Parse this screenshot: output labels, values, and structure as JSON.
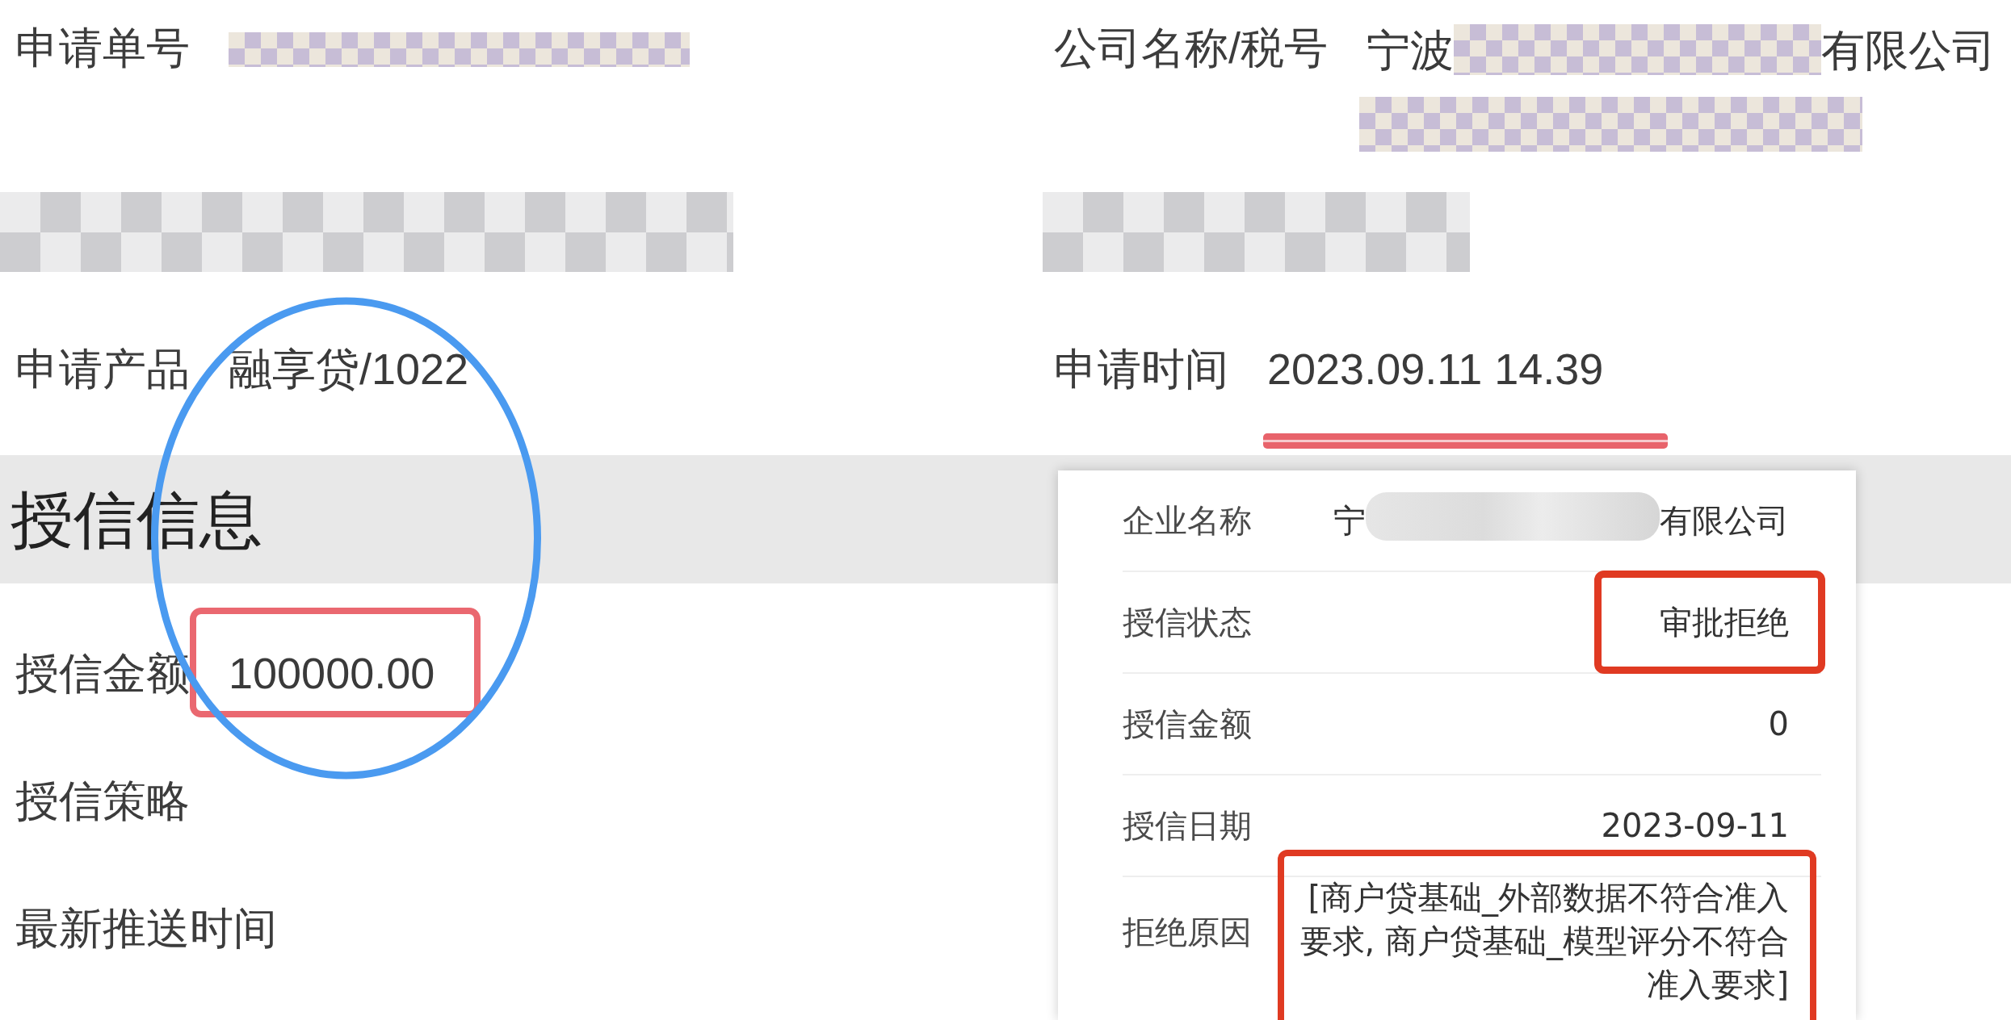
{
  "application_fields": [
    {
      "kind": "masked",
      "label": "申请单号"
    },
    {
      "kind": "company",
      "label": "公司名称/税号",
      "value_start": "宁波",
      "value_end": "有限公司"
    },
    {
      "kind": "masked_row"
    },
    {
      "kind": "masked_row"
    },
    {
      "kind": "text",
      "label": "申请产品",
      "value": "融享贷/1022",
      "underlined": false
    },
    {
      "kind": "text",
      "label": "申请时间",
      "value": "2023.09.11 14.39",
      "underlined": true
    }
  ],
  "credit_section": {
    "title": "授信信息",
    "fields": [
      {
        "label": "授信金额",
        "value": "100000.00",
        "boxed": true
      },
      {
        "label": "授信策略",
        "boxed": false
      },
      {
        "label": "最新推送时间",
        "boxed": false
      }
    ]
  },
  "result_card": {
    "rows": [
      {
        "kind": "company",
        "label": "企业名称",
        "value_start": "宁",
        "value_end": "有限公司"
      },
      {
        "kind": "text",
        "label": "授信状态",
        "value": "审批拒绝",
        "boxed": true
      },
      {
        "kind": "text",
        "label": "授信金额",
        "value": "0",
        "boxed": false
      },
      {
        "kind": "text",
        "label": "授信日期",
        "value": "2023-09-11",
        "boxed": false
      },
      {
        "kind": "long_text",
        "label": "拒绝原因",
        "value": "[商户贷基础_外部数据不符合准入要求, 商户贷基础_模型评分不符合准入要求]",
        "boxed": true
      }
    ]
  }
}
